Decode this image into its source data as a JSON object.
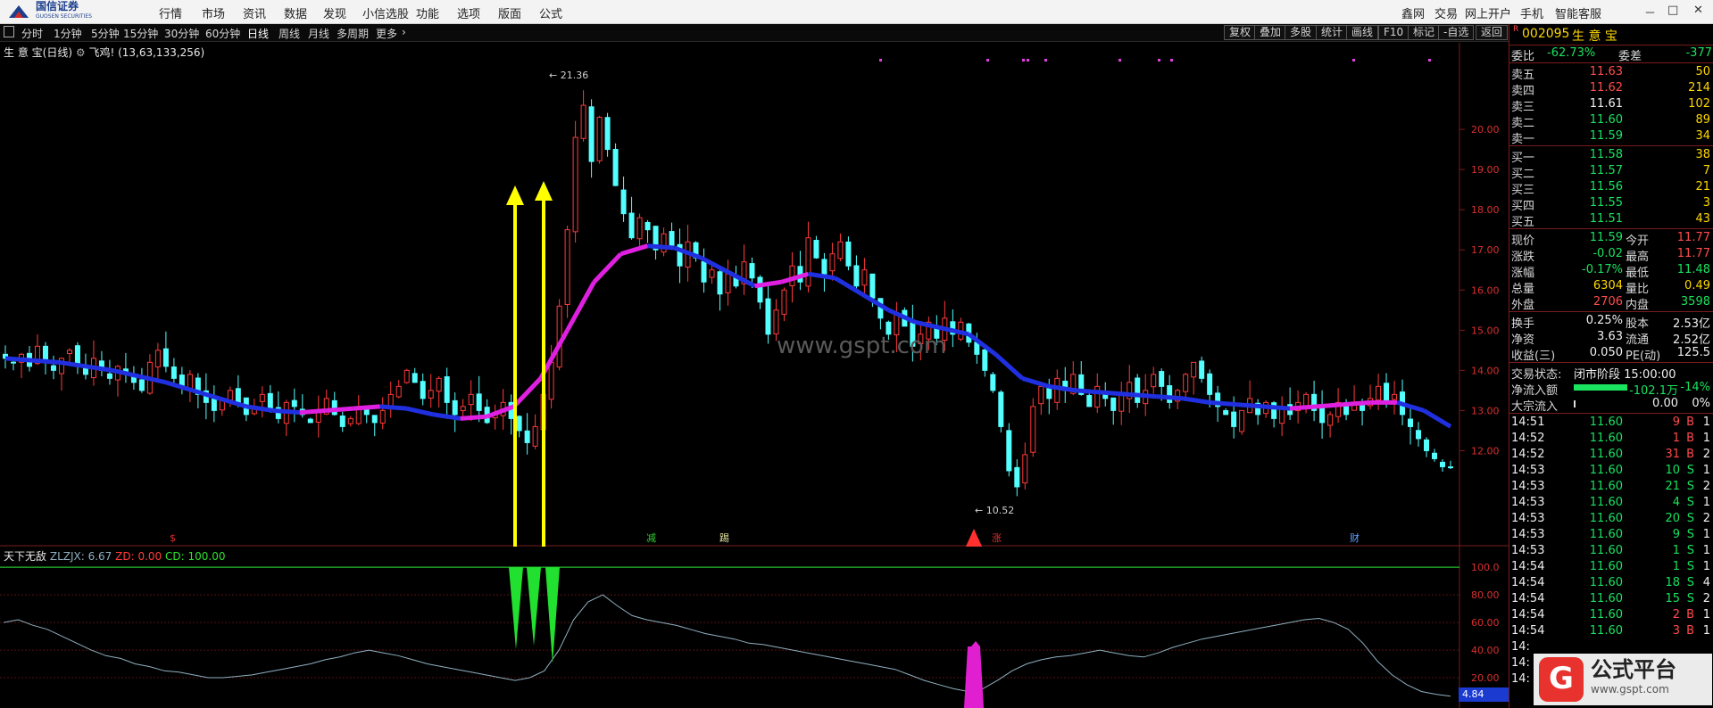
{
  "app": {
    "logo_cn": "国信证券",
    "logo_en": "GUOSEN SECURITIES",
    "menu": [
      "行情",
      "市场",
      "资讯",
      "数据",
      "发现",
      "小信选股",
      "功能",
      "选项",
      "版面",
      "公式"
    ],
    "right_menu": [
      "鑫网",
      "交易",
      "网上开户",
      "手机",
      "智能客服"
    ],
    "window_controls": [
      "－",
      "□",
      "✕"
    ]
  },
  "toolbar": {
    "periods": [
      "分时",
      "1分钟",
      "5分钟",
      "15分钟",
      "30分钟",
      "60分钟",
      "日线",
      "周线",
      "月线",
      "多周期",
      "更多"
    ],
    "active_period": "日线",
    "buttons": [
      "复权",
      "叠加",
      "多股",
      "统计",
      "画线",
      "F10",
      "标记",
      "-自选",
      "返回"
    ]
  },
  "main_chart": {
    "title_name": "生 意 宝",
    "title_period": "(日线)",
    "title_indicator": "飞鸡!",
    "title_params": "(13,63,133,256)",
    "high_label": "21.36",
    "low_label": "10.52",
    "watermark": "www.gspt.com",
    "event_markers": [
      {
        "text": "$",
        "color": "#e03030"
      },
      {
        "text": "减",
        "color": "#30d030"
      },
      {
        "text": "踢",
        "color": "#e0e0a0"
      },
      {
        "text": "涨",
        "color": "#e03030"
      },
      {
        "text": "财",
        "color": "#60a0ff"
      }
    ]
  },
  "indicator": {
    "name": "天下无敌",
    "zlzjx_label": "ZLZJX: 6.67",
    "zd_label": "ZD: 0.00",
    "cd_label": "CD: 100.00",
    "scroll_value": "4.84"
  },
  "chart_data": [
    {
      "type": "candlestick",
      "title": "生 意 宝 (日线)",
      "ylim": [
        10.5,
        21.6
      ],
      "y_ticks": [
        "12.00",
        "13.00",
        "14.00",
        "15.00",
        "16.00",
        "17.00",
        "18.00",
        "19.00",
        "20.00"
      ],
      "high": 21.36,
      "low": 10.52,
      "close_series": [
        14.3,
        14.2,
        14.4,
        14.1,
        14.6,
        14.2,
        14.0,
        14.3,
        14.5,
        14.1,
        13.9,
        14.3,
        14.0,
        13.8,
        14.1,
        13.9,
        13.7,
        13.5,
        14.2,
        14.5,
        14.1,
        13.8,
        13.6,
        13.9,
        13.4,
        13.2,
        13.0,
        13.3,
        13.5,
        13.2,
        12.9,
        13.1,
        13.4,
        13.0,
        12.8,
        13.2,
        13.1,
        12.9,
        12.7,
        13.0,
        13.3,
        12.9,
        12.6,
        12.8,
        13.1,
        12.9,
        12.7,
        13.0,
        13.4,
        13.6,
        14.0,
        13.7,
        13.3,
        13.5,
        13.8,
        13.2,
        12.9,
        13.1,
        13.4,
        13.0,
        12.7,
        12.9,
        13.2,
        12.8,
        12.5,
        12.2,
        12.6,
        13.4,
        14.2,
        15.6,
        17.5,
        19.8,
        20.6,
        19.2,
        20.3,
        19.5,
        18.6,
        17.9,
        17.3,
        17.8,
        17.5,
        17.0,
        17.4,
        17.1,
        16.6,
        17.2,
        16.8,
        16.2,
        16.5,
        15.9,
        16.4,
        16.1,
        16.7,
        16.3,
        15.7,
        14.9,
        15.5,
        16.0,
        16.6,
        16.2,
        17.3,
        16.8,
        16.4,
        16.9,
        17.2,
        16.6,
        16.1,
        16.5,
        15.8,
        15.3,
        14.9,
        15.4,
        15.1,
        14.6,
        14.9,
        15.2,
        14.8,
        15.3,
        14.9,
        15.2,
        14.7,
        14.4,
        14.0,
        13.5,
        12.6,
        11.5,
        11.1,
        11.9,
        13.1,
        13.6,
        13.3,
        13.8,
        13.5,
        13.9,
        13.4,
        13.1,
        13.6,
        13.3,
        13.0,
        13.4,
        13.7,
        13.2,
        13.5,
        13.9,
        13.6,
        13.2,
        13.5,
        13.9,
        14.2,
        13.8,
        13.4,
        13.1,
        12.9,
        12.6,
        13.0,
        13.3,
        12.9,
        13.2,
        12.8,
        13.1,
        12.9,
        13.2,
        13.4,
        13.0,
        12.7,
        12.9,
        13.2,
        12.9,
        13.2,
        13.0,
        13.3,
        13.6,
        13.2,
        13.4,
        12.9,
        12.6,
        12.3,
        12.0,
        11.8,
        11.6,
        11.59
      ],
      "ma_series": [
        {
          "name": "MA-blue",
          "values": [
            14.3,
            14.25,
            14.2,
            14.1,
            14.0,
            13.85,
            13.7,
            13.5,
            13.3,
            13.1,
            13.0,
            12.95,
            13.0,
            13.05,
            13.1,
            13.05,
            12.9,
            12.8,
            12.85,
            13.1,
            13.8,
            15.0,
            16.2,
            16.9,
            17.1,
            17.05,
            16.8,
            16.45,
            16.1,
            16.2,
            16.4,
            16.3,
            15.9,
            15.5,
            15.2,
            15.05,
            14.9,
            14.4,
            13.8,
            13.6,
            13.5,
            13.45,
            13.4,
            13.35,
            13.3,
            13.2,
            13.15,
            13.1,
            13.05,
            13.1,
            13.15,
            13.2,
            13.2,
            13.0,
            12.6
          ]
        }
      ]
    },
    {
      "type": "line",
      "title": "天下无敌",
      "ylim": [
        0,
        100
      ],
      "y_ticks": [
        "20.00",
        "40.00",
        "60.00",
        "80.00",
        "100.0"
      ],
      "series": [
        {
          "name": "ZLZJX",
          "values": [
            60,
            62,
            58,
            55,
            50,
            45,
            40,
            36,
            34,
            30,
            28,
            25,
            24,
            22,
            20,
            20,
            21,
            22,
            24,
            26,
            28,
            30,
            33,
            35,
            38,
            40,
            38,
            36,
            33,
            30,
            28,
            26,
            24,
            22,
            20,
            18,
            20,
            25,
            40,
            62,
            75,
            80,
            72,
            65,
            62,
            60,
            58,
            55,
            52,
            50,
            48,
            45,
            44,
            42,
            40,
            38,
            36,
            34,
            32,
            30,
            28,
            26,
            22,
            18,
            15,
            12,
            10,
            12,
            18,
            25,
            30,
            33,
            35,
            36,
            38,
            40,
            38,
            36,
            35,
            38,
            42,
            45,
            48,
            50,
            52,
            54,
            56,
            58,
            60,
            62,
            63,
            60,
            55,
            45,
            32,
            22,
            15,
            10,
            8,
            6.67
          ]
        }
      ],
      "ref_line": 100
    }
  ],
  "quote": {
    "code": "002095",
    "name": "生 意 宝",
    "wei_bi_label": "委比",
    "wei_bi": "-62.73%",
    "wei_cha_label": "委差",
    "wei_cha": "-377",
    "sells": [
      {
        "label": "卖五",
        "price": "11.63",
        "vol": "50"
      },
      {
        "label": "卖四",
        "price": "11.62",
        "vol": "214"
      },
      {
        "label": "卖三",
        "price": "11.61",
        "vol": "102"
      },
      {
        "label": "卖二",
        "price": "11.60",
        "vol": "89"
      },
      {
        "label": "卖一",
        "price": "11.59",
        "vol": "34"
      }
    ],
    "buys": [
      {
        "label": "买一",
        "price": "11.58",
        "vol": "38"
      },
      {
        "label": "买二",
        "price": "11.57",
        "vol": "7"
      },
      {
        "label": "买三",
        "price": "11.56",
        "vol": "21"
      },
      {
        "label": "买四",
        "price": "11.55",
        "vol": "3"
      },
      {
        "label": "买五",
        "price": "11.51",
        "vol": "43"
      }
    ],
    "stats": [
      {
        "l1": "现价",
        "v1": "11.59",
        "c1": "green",
        "l2": "今开",
        "v2": "11.77",
        "c2": "red"
      },
      {
        "l1": "涨跌",
        "v1": "-0.02",
        "c1": "green",
        "l2": "最高",
        "v2": "11.77",
        "c2": "red"
      },
      {
        "l1": "涨幅",
        "v1": "-0.17%",
        "c1": "green",
        "l2": "最低",
        "v2": "11.48",
        "c2": "green"
      },
      {
        "l1": "总量",
        "v1": "6304",
        "c1": "yellow",
        "l2": "量比",
        "v2": "0.49",
        "c2": "yellow"
      },
      {
        "l1": "外盘",
        "v1": "2706",
        "c1": "red",
        "l2": "内盘",
        "v2": "3598",
        "c2": "green"
      }
    ],
    "stats2": [
      {
        "l1": "换手",
        "v1": "0.25%",
        "l2": "股本",
        "v2": "2.53亿"
      },
      {
        "l1": "净资",
        "v1": "3.63",
        "l2": "流通",
        "v2": "2.52亿"
      },
      {
        "l1": "收益(三)",
        "v1": "0.050",
        "l2": "PE(动)",
        "v2": "125.5"
      }
    ],
    "trade_status_label": "交易状态:",
    "trade_status": "闭市阶段 15:00:00",
    "net_inflow_label": "净流入额",
    "net_inflow": "-102.1万",
    "net_inflow_pct": "-14%",
    "block_inflow_label": "大宗流入",
    "block_inflow": "0.00",
    "block_inflow_pct": "0%",
    "ticks": [
      {
        "t": "14:51",
        "p": "11.60",
        "v": "9",
        "d": "B",
        "n": "1"
      },
      {
        "t": "14:52",
        "p": "11.60",
        "v": "1",
        "d": "B",
        "n": "1"
      },
      {
        "t": "14:52",
        "p": "11.60",
        "v": "31",
        "d": "B",
        "n": "2"
      },
      {
        "t": "14:53",
        "p": "11.60",
        "v": "10",
        "d": "S",
        "n": "1"
      },
      {
        "t": "14:53",
        "p": "11.60",
        "v": "21",
        "d": "S",
        "n": "2"
      },
      {
        "t": "14:53",
        "p": "11.60",
        "v": "4",
        "d": "S",
        "n": "1"
      },
      {
        "t": "14:53",
        "p": "11.60",
        "v": "20",
        "d": "S",
        "n": "2"
      },
      {
        "t": "14:53",
        "p": "11.60",
        "v": "9",
        "d": "S",
        "n": "1"
      },
      {
        "t": "14:53",
        "p": "11.60",
        "v": "1",
        "d": "S",
        "n": "1"
      },
      {
        "t": "14:54",
        "p": "11.60",
        "v": "1",
        "d": "S",
        "n": "1"
      },
      {
        "t": "14:54",
        "p": "11.60",
        "v": "18",
        "d": "S",
        "n": "4"
      },
      {
        "t": "14:54",
        "p": "11.60",
        "v": "15",
        "d": "S",
        "n": "2"
      },
      {
        "t": "14:54",
        "p": "11.60",
        "v": "2",
        "d": "B",
        "n": "1"
      },
      {
        "t": "14:54",
        "p": "11.60",
        "v": "3",
        "d": "B",
        "n": "1"
      },
      {
        "t": "14:",
        "p": "",
        "v": "",
        "d": "",
        "n": ""
      },
      {
        "t": "14:",
        "p": "",
        "v": "",
        "d": "",
        "n": ""
      },
      {
        "t": "14:",
        "p": "",
        "v": "",
        "d": "",
        "n": ""
      }
    ]
  },
  "watermark_brand": {
    "cn": "公式平台",
    "url": "www.gspt.com"
  }
}
